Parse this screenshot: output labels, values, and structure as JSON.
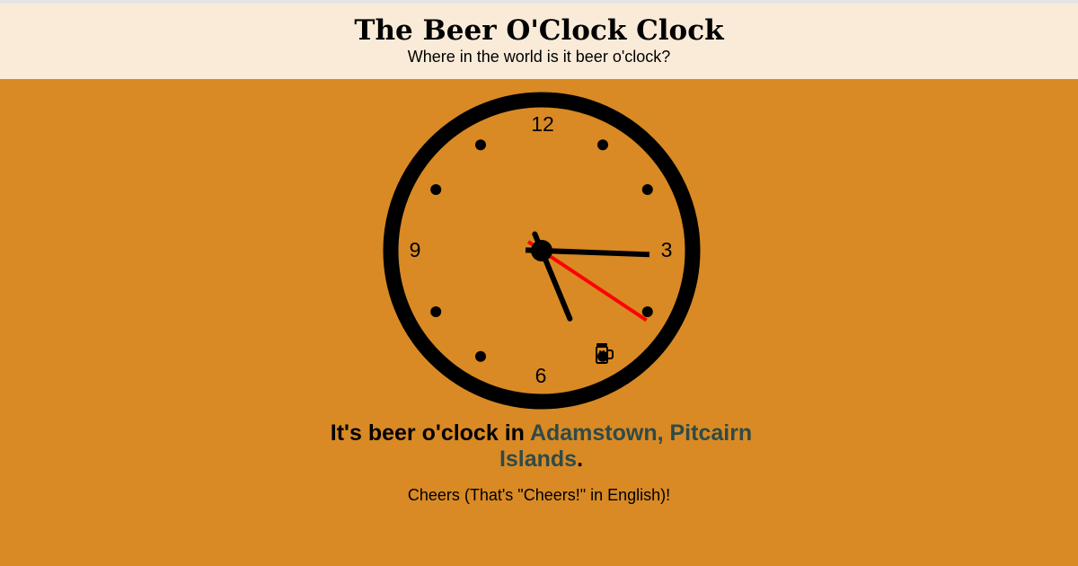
{
  "header": {
    "title": "The Beer O'Clock Clock",
    "subtitle": "Where in the world is it beer o'clock?"
  },
  "clock": {
    "numerals": {
      "twelve": "12",
      "three": "3",
      "six": "6",
      "nine": "9"
    },
    "time": {
      "hours": 5,
      "minutes": 15,
      "seconds": 20.6
    },
    "icon": "beer-mug-icon",
    "colors": {
      "face": "#d98a24",
      "rim": "#000000",
      "second_hand": "#ff0000"
    }
  },
  "message": {
    "prefix": "It's beer o'clock in ",
    "location": "Adamstown, Pitcairn Islands",
    "suffix": "."
  },
  "cheers": "Cheers (That's \"Cheers!\" in English)!",
  "colors": {
    "background": "#d98a24",
    "header_background": "#faebd9",
    "location_link": "#2f4a48"
  }
}
